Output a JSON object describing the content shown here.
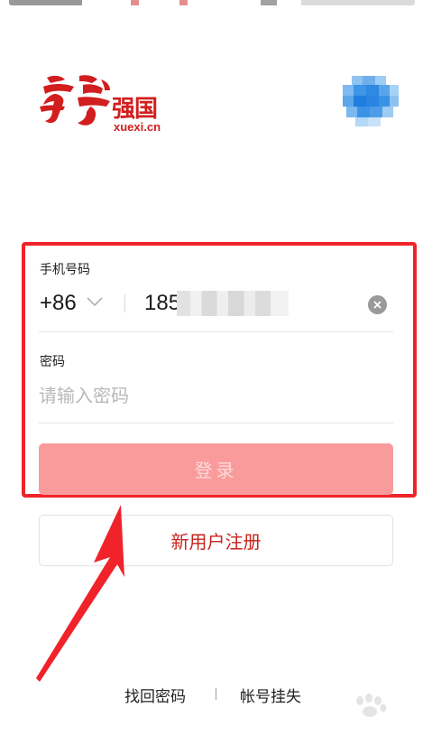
{
  "logo": {
    "name": "强国",
    "url": "xuexi.cn"
  },
  "form": {
    "phone_label": "手机号码",
    "country_code": "+86",
    "phone_value_visible": "185",
    "password_label": "密码",
    "password_placeholder": "请输入密码",
    "login_label": "登录"
  },
  "register_label": "新用户注册",
  "footer": {
    "find_password": "找回密码",
    "account_lost": "帐号挂失"
  },
  "colors": {
    "brand_red": "#d21e1e",
    "login_button": "#fa9b9b",
    "annotation_red": "#f0232a"
  },
  "icons": {
    "chevron": "chevron-down-icon",
    "clear": "clear-icon",
    "avatar": "avatar"
  }
}
